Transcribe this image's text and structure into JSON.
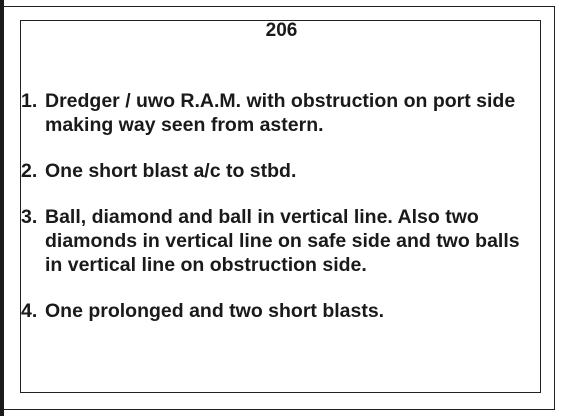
{
  "card": {
    "number": "206",
    "answers": [
      {
        "num": "1.",
        "text": "Dredger / uwo R.A.M. with obstruction on port side making way seen from astern."
      },
      {
        "num": "2.",
        "text": "One short blast a/c to stbd."
      },
      {
        "num": "3.",
        "text": "Ball, diamond and ball in vertical line. Also two diamonds in vertical line on safe side and two balls in vertical line on obstruction side."
      },
      {
        "num": "4.",
        "text": "One prolonged and two short blasts."
      }
    ]
  }
}
